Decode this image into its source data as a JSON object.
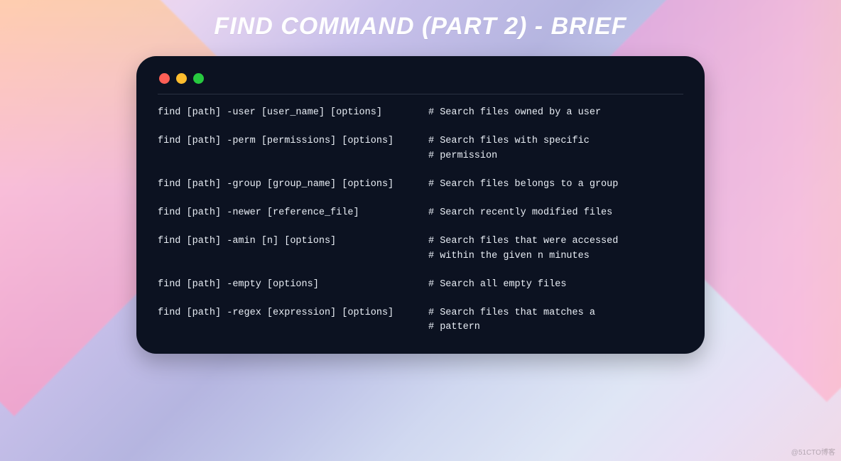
{
  "title": "FIND COMMAND (PART 2) - BRIEF",
  "watermark": "@51CTO博客",
  "terminal": {
    "dots": [
      "red",
      "yellow",
      "green"
    ]
  },
  "commands": [
    {
      "cmd": "find [path] -user [user_name] [options]",
      "comment": [
        "# Search files owned by a user"
      ]
    },
    {
      "cmd": "find [path] -perm [permissions] [options]",
      "comment": [
        "# Search files with specific",
        "# permission"
      ]
    },
    {
      "cmd": "find [path] -group [group_name] [options]",
      "comment": [
        "# Search files belongs to a group"
      ]
    },
    {
      "cmd": "find [path] -newer [reference_file]",
      "comment": [
        "# Search recently modified files"
      ]
    },
    {
      "cmd": "find [path] -amin [n] [options]",
      "comment": [
        "# Search files that were accessed",
        "# within the given n minutes"
      ]
    },
    {
      "cmd": "find [path] -empty [options]",
      "comment": [
        "# Search all empty files"
      ]
    },
    {
      "cmd": "find [path] -regex [expression] [options]",
      "comment": [
        "# Search files that matches a",
        "# pattern"
      ]
    }
  ]
}
